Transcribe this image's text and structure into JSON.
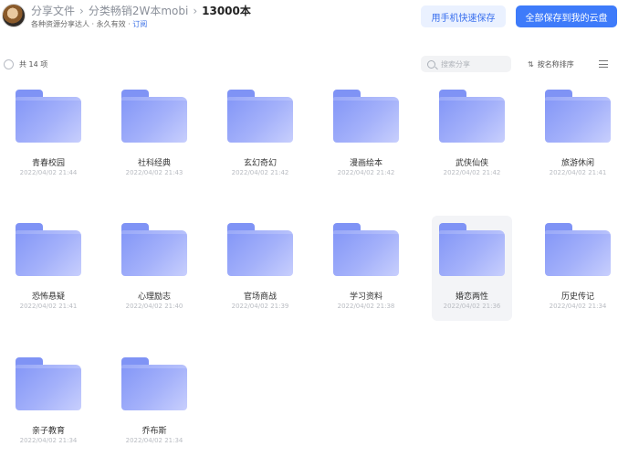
{
  "header": {
    "breadcrumb": [
      "分享文件",
      "分类畅销2W本mobi",
      "13000本"
    ],
    "subtitle_owner": "各种资源分享达人 · 永久有效 · ",
    "subtitle_link": "订阅",
    "btn_phone_save": "用手机快速保存",
    "btn_save_all": "全部保存到我的云盘"
  },
  "toolbar": {
    "count_label": "共 14 项",
    "search_placeholder": "搜索分享",
    "sort_label": "按名称排序"
  },
  "icons": {
    "avatar": "avatar-image",
    "folder": "folder-icon",
    "search": "search-icon",
    "sort": "sort-arrows-icon",
    "view": "list-menu-icon"
  },
  "colors": {
    "accent": "#3e7bfa",
    "folder": "#8b9cf8"
  },
  "folders": [
    {
      "name": "青春校园",
      "date": "2022/04/02 21:44"
    },
    {
      "name": "社科经典",
      "date": "2022/04/02 21:43"
    },
    {
      "name": "玄幻奇幻",
      "date": "2022/04/02 21:42"
    },
    {
      "name": "漫画绘本",
      "date": "2022/04/02 21:42"
    },
    {
      "name": "武侠仙侠",
      "date": "2022/04/02 21:42"
    },
    {
      "name": "旅游休闲",
      "date": "2022/04/02 21:41"
    },
    {
      "name": "恐怖悬疑",
      "date": "2022/04/02 21:41"
    },
    {
      "name": "心理励志",
      "date": "2022/04/02 21:40"
    },
    {
      "name": "官场商战",
      "date": "2022/04/02 21:39"
    },
    {
      "name": "学习资料",
      "date": "2022/04/02 21:38"
    },
    {
      "name": "婚恋两性",
      "date": "2022/04/02 21:36"
    },
    {
      "name": "历史传记",
      "date": "2022/04/02 21:34"
    },
    {
      "name": "亲子教育",
      "date": "2022/04/02 21:34"
    },
    {
      "name": "乔布斯",
      "date": "2022/04/02 21:34"
    }
  ]
}
